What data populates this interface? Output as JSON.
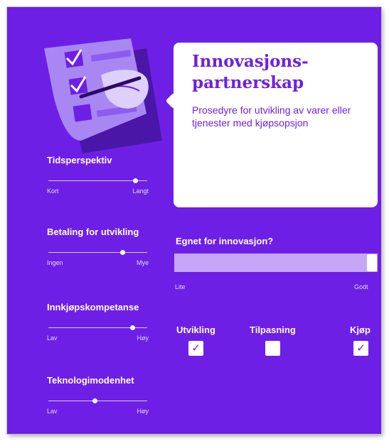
{
  "colors": {
    "background": "#6e1fe6",
    "box": "#ffffff",
    "gauge": "#c6a7f7",
    "text_light": "#ffffff"
  },
  "illustration": {
    "icon": "checklist-hand-pen-icon"
  },
  "info": {
    "title": "Innovasjons-partnerskap",
    "description": "Prosedyre for utvikling av varer eller tjenester med kjøpsopsjon"
  },
  "sliders": [
    {
      "title": "Tidsperspektiv",
      "low": "Kort",
      "high": "Langt",
      "value": 0.88
    },
    {
      "title": "Betaling for utvikling",
      "low": "Ingen",
      "high": "Mye",
      "value": 0.75
    },
    {
      "title": "Innkjøpskompetanse",
      "low": "Lav",
      "high": "Høy",
      "value": 0.85
    },
    {
      "title": "Teknologimodenhet",
      "low": "Lav",
      "high": "Høy",
      "value": 0.47
    }
  ],
  "gauge": {
    "title": "Egnet for innovasjon?",
    "low": "Lite",
    "high": "Godt",
    "value": 1.0
  },
  "checkboxes": [
    {
      "label": "Utvikling",
      "checked": true
    },
    {
      "label": "Tilpasning",
      "checked": false
    },
    {
      "label": "Kjøp",
      "checked": true
    }
  ],
  "check_mark": "✓"
}
